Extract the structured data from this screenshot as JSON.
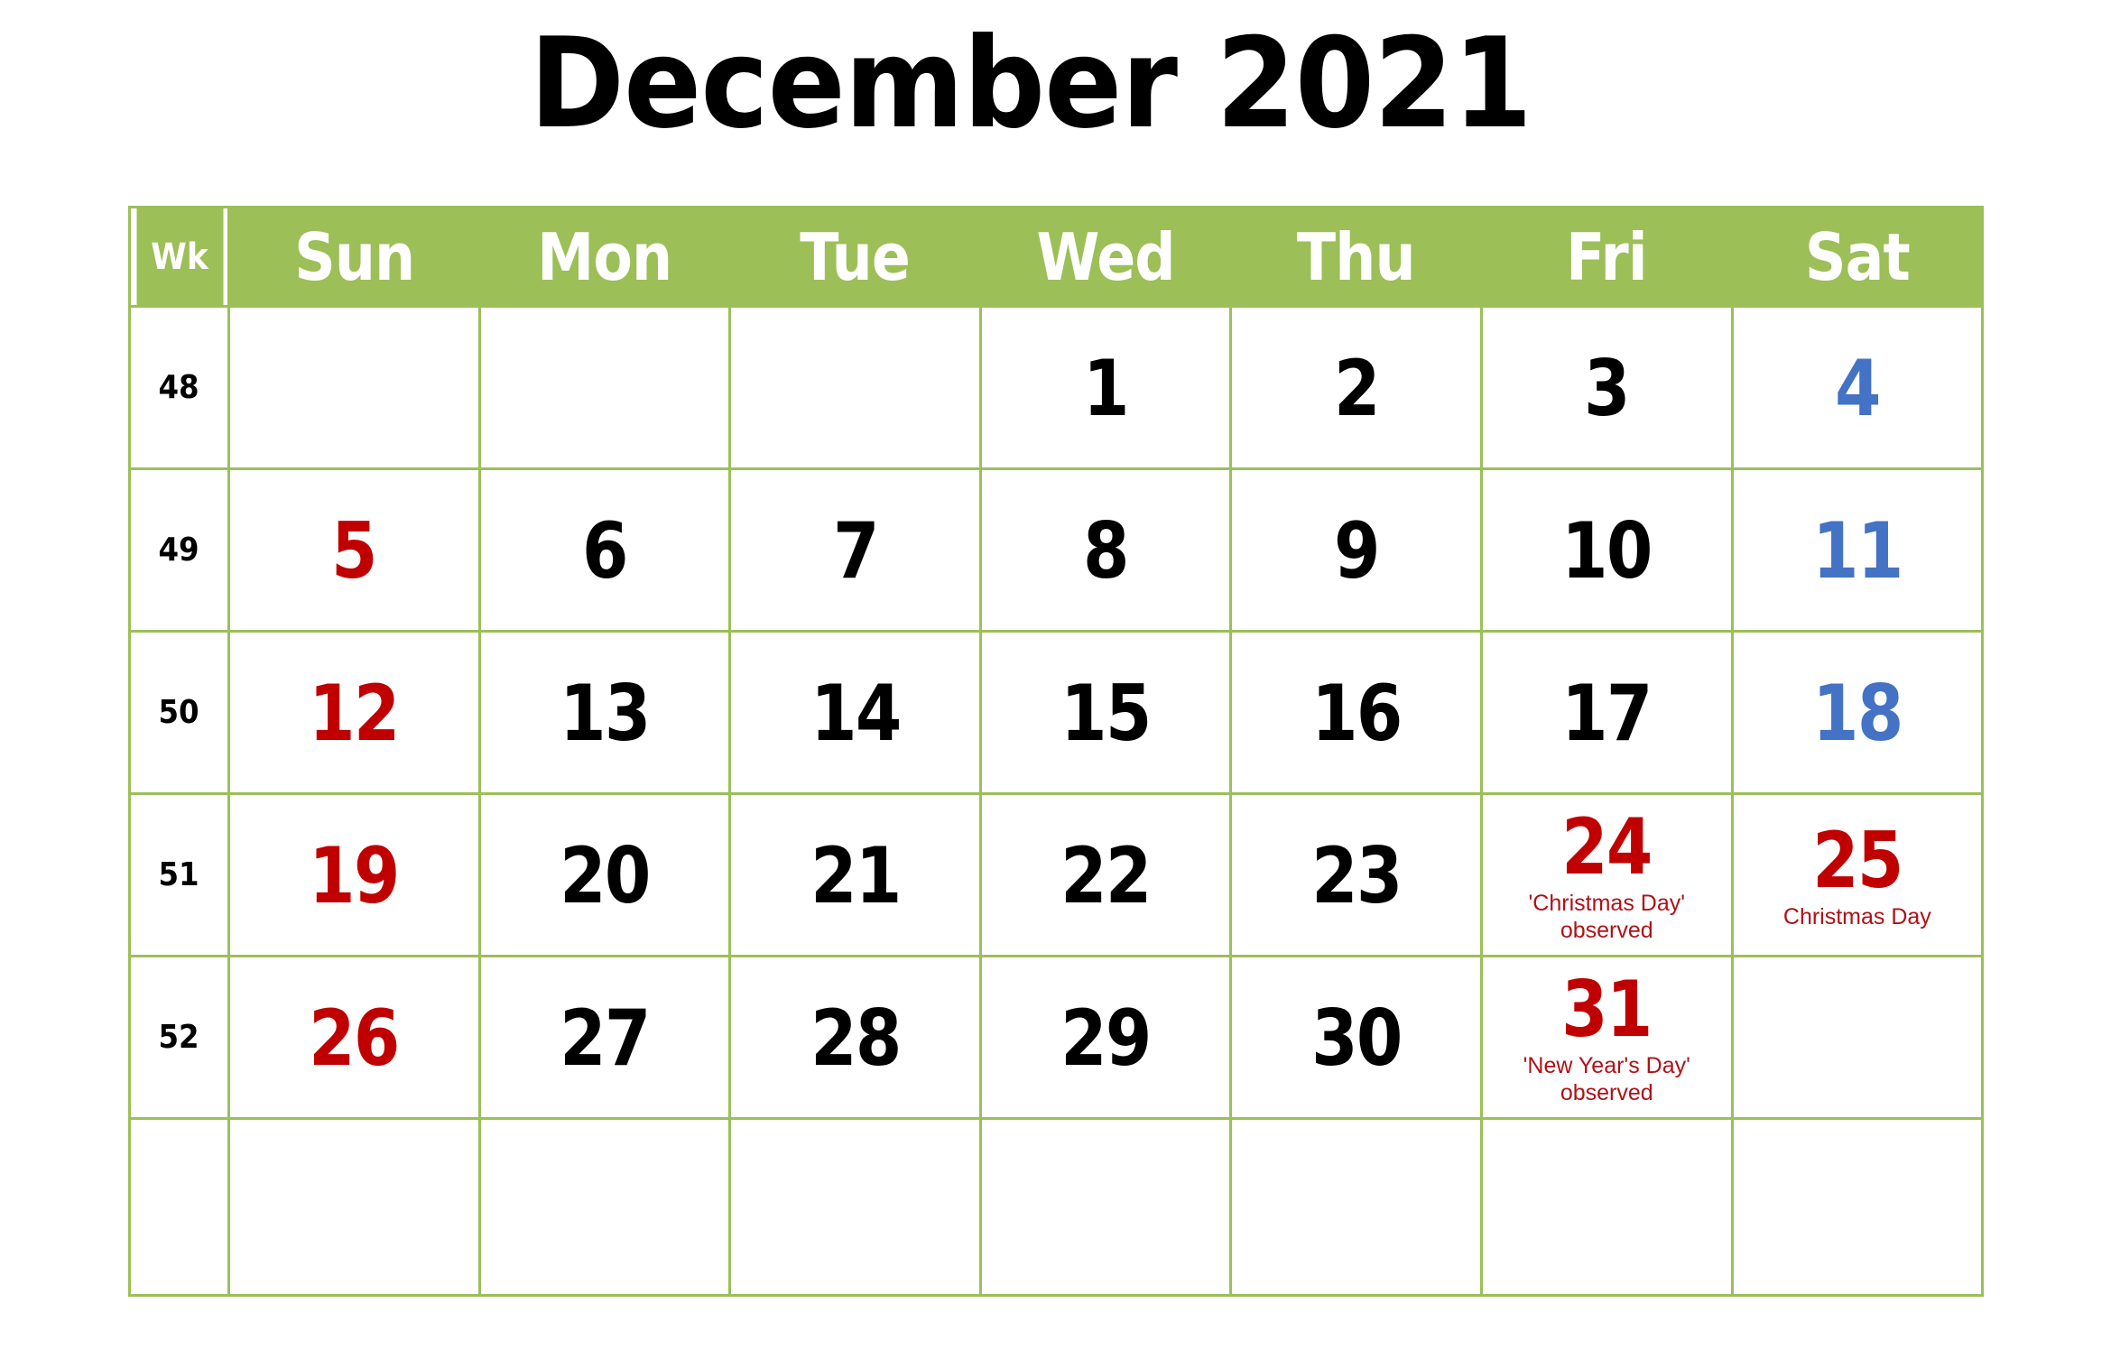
{
  "title": "December 2021",
  "colors": {
    "header_bg": "#9CBF58",
    "border": "#9CBF58",
    "sunday": "#C00000",
    "saturday": "#4472C4",
    "weekday": "#000000",
    "holiday_text": "#B01116",
    "page_bg": "#FFFFFF"
  },
  "header": {
    "week_label": "Wk",
    "days": [
      "Sun",
      "Mon",
      "Tue",
      "Wed",
      "Thu",
      "Fri",
      "Sat"
    ]
  },
  "weeks": [
    {
      "wk": "48",
      "days": [
        {
          "num": "",
          "kind": "empty",
          "note": ""
        },
        {
          "num": "",
          "kind": "empty",
          "note": ""
        },
        {
          "num": "",
          "kind": "empty",
          "note": ""
        },
        {
          "num": "1",
          "kind": "weekday",
          "note": ""
        },
        {
          "num": "2",
          "kind": "weekday",
          "note": ""
        },
        {
          "num": "3",
          "kind": "weekday",
          "note": ""
        },
        {
          "num": "4",
          "kind": "saturday",
          "note": ""
        }
      ]
    },
    {
      "wk": "49",
      "days": [
        {
          "num": "5",
          "kind": "sunday",
          "note": ""
        },
        {
          "num": "6",
          "kind": "weekday",
          "note": ""
        },
        {
          "num": "7",
          "kind": "weekday",
          "note": ""
        },
        {
          "num": "8",
          "kind": "weekday",
          "note": ""
        },
        {
          "num": "9",
          "kind": "weekday",
          "note": ""
        },
        {
          "num": "10",
          "kind": "weekday",
          "note": ""
        },
        {
          "num": "11",
          "kind": "saturday",
          "note": ""
        }
      ]
    },
    {
      "wk": "50",
      "days": [
        {
          "num": "12",
          "kind": "sunday",
          "note": ""
        },
        {
          "num": "13",
          "kind": "weekday",
          "note": ""
        },
        {
          "num": "14",
          "kind": "weekday",
          "note": ""
        },
        {
          "num": "15",
          "kind": "weekday",
          "note": ""
        },
        {
          "num": "16",
          "kind": "weekday",
          "note": ""
        },
        {
          "num": "17",
          "kind": "weekday",
          "note": ""
        },
        {
          "num": "18",
          "kind": "saturday",
          "note": ""
        }
      ]
    },
    {
      "wk": "51",
      "days": [
        {
          "num": "19",
          "kind": "sunday",
          "note": ""
        },
        {
          "num": "20",
          "kind": "weekday",
          "note": ""
        },
        {
          "num": "21",
          "kind": "weekday",
          "note": ""
        },
        {
          "num": "22",
          "kind": "weekday",
          "note": ""
        },
        {
          "num": "23",
          "kind": "weekday",
          "note": ""
        },
        {
          "num": "24",
          "kind": "holiday",
          "note": "'Christmas Day'\nobserved"
        },
        {
          "num": "25",
          "kind": "holiday",
          "note": "Christmas Day"
        }
      ]
    },
    {
      "wk": "52",
      "days": [
        {
          "num": "26",
          "kind": "sunday",
          "note": ""
        },
        {
          "num": "27",
          "kind": "weekday",
          "note": ""
        },
        {
          "num": "28",
          "kind": "weekday",
          "note": ""
        },
        {
          "num": "29",
          "kind": "weekday",
          "note": ""
        },
        {
          "num": "30",
          "kind": "weekday",
          "note": ""
        },
        {
          "num": "31",
          "kind": "holiday",
          "note": "'New Year's Day'\nobserved"
        },
        {
          "num": "",
          "kind": "empty",
          "note": ""
        }
      ]
    },
    {
      "wk": "",
      "days": [
        {
          "num": "",
          "kind": "empty",
          "note": ""
        },
        {
          "num": "",
          "kind": "empty",
          "note": ""
        },
        {
          "num": "",
          "kind": "empty",
          "note": ""
        },
        {
          "num": "",
          "kind": "empty",
          "note": ""
        },
        {
          "num": "",
          "kind": "empty",
          "note": ""
        },
        {
          "num": "",
          "kind": "empty",
          "note": ""
        },
        {
          "num": "",
          "kind": "empty",
          "note": ""
        }
      ]
    }
  ]
}
